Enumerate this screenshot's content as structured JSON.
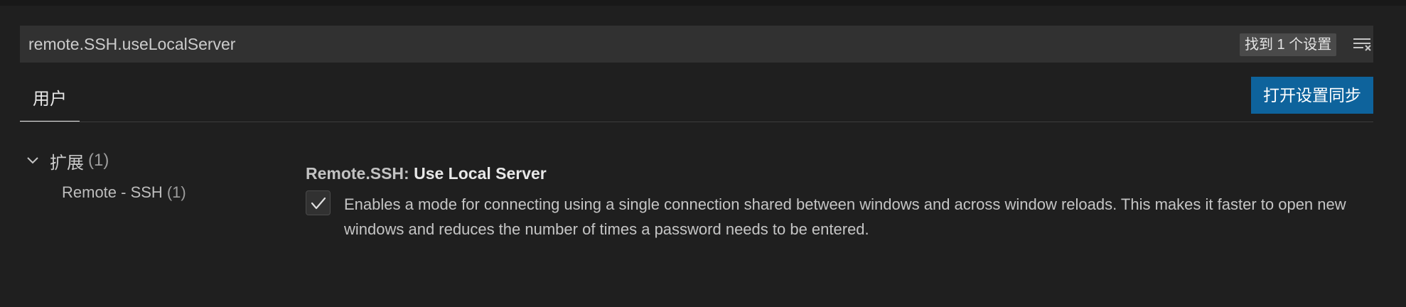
{
  "search": {
    "value": "remote.SSH.useLocalServer",
    "result_count": "找到 1 个设置",
    "clear_icon": "clear-filter-icon"
  },
  "tabs": [
    {
      "label": "用户",
      "active": true
    }
  ],
  "sync_button": {
    "label": "打开设置同步"
  },
  "toc": {
    "group": {
      "label": "扩展",
      "count": "(1)",
      "expanded": true,
      "icon": "chevron-down-icon"
    },
    "items": [
      {
        "label": "Remote - SSH",
        "count": "(1)"
      }
    ]
  },
  "setting": {
    "category": "Remote.SSH: ",
    "name": "Use Local Server",
    "checked": true,
    "description": "Enables a mode for connecting using a single connection shared between windows and across window reloads. This makes it faster to open new windows and reduces the number of times a password needs to be entered."
  },
  "colors": {
    "background": "#1f1f1f",
    "input_background": "#313131",
    "button_background": "#0e639c",
    "tab_underline": "#e7e7e7"
  }
}
